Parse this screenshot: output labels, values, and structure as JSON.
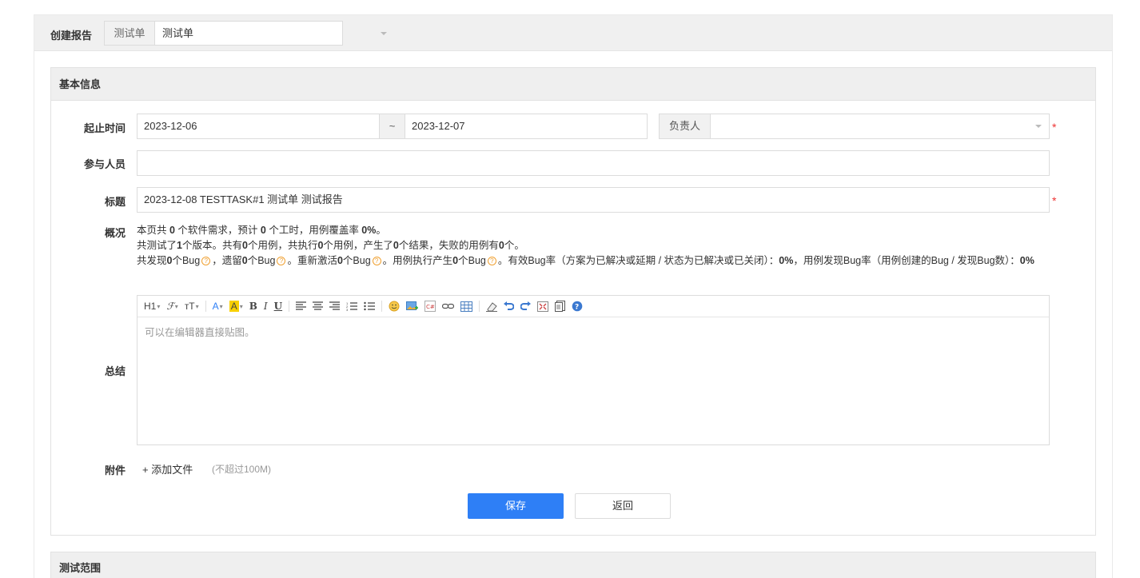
{
  "header": {
    "title": "创建报告",
    "select_addon": "测试单",
    "select_value": "测试单"
  },
  "basic": {
    "section_title": "基本信息",
    "date_label": "起止时间",
    "date_start": "2023-12-06",
    "date_sep": "~",
    "date_end": "2023-12-07",
    "owner_label": "负责人",
    "owner_value": "",
    "required_mark": "*",
    "members_label": "参与人员",
    "members_value": "",
    "title_label": "标题",
    "title_value": "2023-12-08 TESTTASK#1 测试单 测试报告",
    "overview_label": "概况",
    "overview": {
      "l1_a": "本页共 ",
      "l1_b": "0",
      "l1_c": " 个软件需求，预计 ",
      "l1_d": "0",
      "l1_e": " 个工时，用例覆盖率 ",
      "l1_f": "0%",
      "l1_g": "。",
      "l2_a": "共测试了",
      "l2_b": "1",
      "l2_c": "个版本。共有",
      "l2_d": "0",
      "l2_e": "个用例，共执行",
      "l2_f": "0",
      "l2_g": "个用例，产生了",
      "l2_h": "0",
      "l2_i": "个结果，失败的用例有",
      "l2_j": "0",
      "l2_k": "个。",
      "l3_a": "共发现",
      "l3_b": "0",
      "l3_c": "个Bug",
      "l3_d": "，遗留",
      "l3_e": "0",
      "l3_f": "个Bug",
      "l3_g": "。重新激活",
      "l3_h": "0",
      "l3_i": "个Bug",
      "l3_j": "。用例执行产生",
      "l3_k": "0",
      "l3_l": "个Bug",
      "l3_m": "。有效Bug率（方案为已解决或延期 / 状态为已解决或已关闭）：",
      "l3_n": "0%",
      "l3_o": "，用例发现Bug率（用例创建的Bug / 发现Bug数）：",
      "l3_p": "0%"
    },
    "summary_label": "总结",
    "editor_placeholder": "可以在编辑器直接贴图。",
    "toolbar": {
      "heading": "H1",
      "font": "ℱ",
      "size": "тT",
      "color": "A",
      "bg": "A",
      "bold": "B",
      "italic": "I",
      "underline": "U"
    },
    "attach_label": "附件",
    "attach_add": "+ 添加文件",
    "attach_hint": "(不超过100M)",
    "save_label": "保存",
    "back_label": "返回"
  },
  "scope": {
    "section_title": "测试范围"
  },
  "colors": {
    "primary": "#2e7ff6",
    "required": "#ee3333",
    "help_icon": "#f0a030"
  }
}
